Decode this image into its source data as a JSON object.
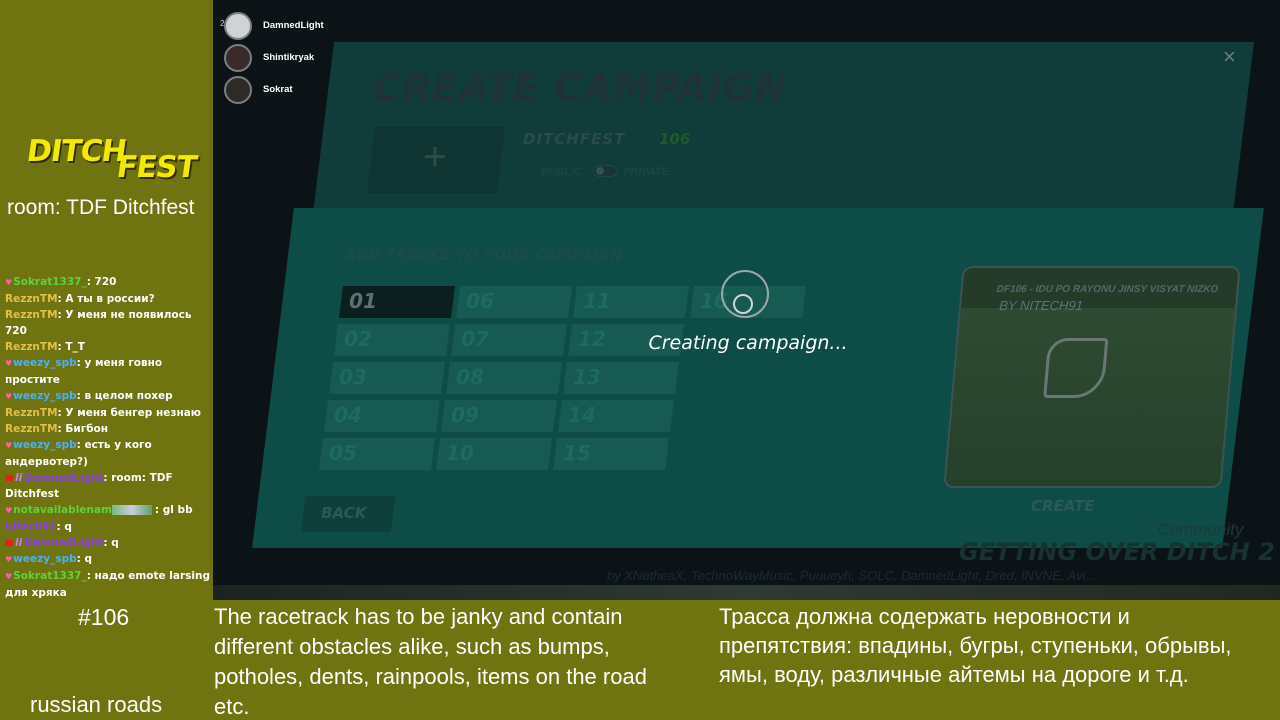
{
  "sidebar": {
    "logo_line1": "DITCH",
    "logo_line2": "FEST",
    "room": "room: TDF Ditchfest",
    "chat": [
      {
        "user": "Sokrat1337_",
        "text": ": 720",
        "color": "#5cd23c",
        "badge": "heart"
      },
      {
        "user": "RezznTM",
        "text": ": А ты в россии?",
        "color": "#e3c04a",
        "badge": ""
      },
      {
        "user": "RezznTM",
        "text": ": У меня не появилось 720",
        "color": "#e3c04a",
        "badge": ""
      },
      {
        "user": "RezznTM",
        "text": ": T_T",
        "color": "#e3c04a",
        "badge": ""
      },
      {
        "user": "weezy_spb",
        "text": ": у меня говно простите",
        "color": "#4cb0f2",
        "badge": "heart"
      },
      {
        "user": "weezy_spb",
        "text": ": в целом похер",
        "color": "#4cb0f2",
        "badge": "heart"
      },
      {
        "user": "RezznTM",
        "text": ": У меня бенгер незнаю",
        "color": "#e3c04a",
        "badge": ""
      },
      {
        "user": "RezznTM",
        "text": ": Бигбон",
        "color": "#e3c04a",
        "badge": ""
      },
      {
        "user": "weezy_spb",
        "text": ": есть у кого андервотер?)",
        "color": "#4cb0f2",
        "badge": "heart"
      },
      {
        "user": "DamnedLight",
        "text": ": room: TDF Ditchfest",
        "color": "#8d3fe8",
        "badge": "yt-li"
      },
      {
        "user": "notavailablenam",
        "text": ": gl bb",
        "color": "#5cd23c",
        "badge": "heart-wide",
        "emote": "wide"
      },
      {
        "user": "nitech91",
        "text": ": q",
        "color": "#8d3fe8",
        "badge": ""
      },
      {
        "user": "DamnedLight",
        "text": ": q",
        "color": "#8d3fe8",
        "badge": "yt-li"
      },
      {
        "user": "weezy_spb",
        "text": ": q",
        "color": "#4cb0f2",
        "badge": "heart"
      },
      {
        "user": "Sokrat1337_",
        "text": ": надо emote larsing для хряка",
        "color": "#5cd23c",
        "badge": "heart"
      },
      {
        "user": "Sokrat1337_",
        "text": ":",
        "color": "#5cd23c",
        "badge": "heart",
        "emote": "car"
      }
    ]
  },
  "players": [
    {
      "rank": "2",
      "name": "DamnedLight",
      "avatar_color": "#cfd3d4"
    },
    {
      "rank": "",
      "name": "Shintikryak",
      "avatar_color": "#3a2a2a"
    },
    {
      "rank": "",
      "name": "Sokrat",
      "avatar_color": "#2e2a26"
    }
  ],
  "game": {
    "title": "CREATE CAMPAIGN",
    "close": "×",
    "plus": "+",
    "campaign_name": "DITCHFEST",
    "campaign_number": "106",
    "public_label": "PUBLIC",
    "private_label": "PRIVATE",
    "add_tracks_label": "ADD TRACKS TO YOUR CAMPAIGN",
    "tracks": [
      "01",
      "02",
      "03",
      "04",
      "05",
      "06",
      "07",
      "08",
      "09",
      "10",
      "11",
      "12",
      "13",
      "14",
      "15",
      "16"
    ],
    "selected_track": "01",
    "loading_text": "Creating campaign...",
    "preview_title": "DF106 - IDU PO RAYONU JINSY VISYAT NIZKO",
    "preview_author": "BY NITECH91",
    "back_label": "BACK",
    "create_label": "CREATE",
    "watermark_community": ": Community",
    "watermark_game": "GETTING OVER DITCH 2",
    "watermark_credits": "by XNetheaX, TechnoWayMusic, Puuueyh, SOLC, DamnedLight, Dred, INVNE, Avi..."
  },
  "bottom": {
    "episode": "#106",
    "theme": "russian roads",
    "rules_en": "The racetrack has to be janky and contain different obstacles alike, such as bumps, potholes, dents, rainpools, items on the road etc.",
    "rules_ru": "Трасса должна содержать неровности и препятствия: впадины, бугры, ступеньки, обрывы, ямы, воду, различные айтемы на дороге и т.д."
  },
  "colors": {
    "overlay_bg": "#6f7310",
    "logo_yellow": "#f2ea00",
    "panel_teal": "#0e4d47"
  }
}
